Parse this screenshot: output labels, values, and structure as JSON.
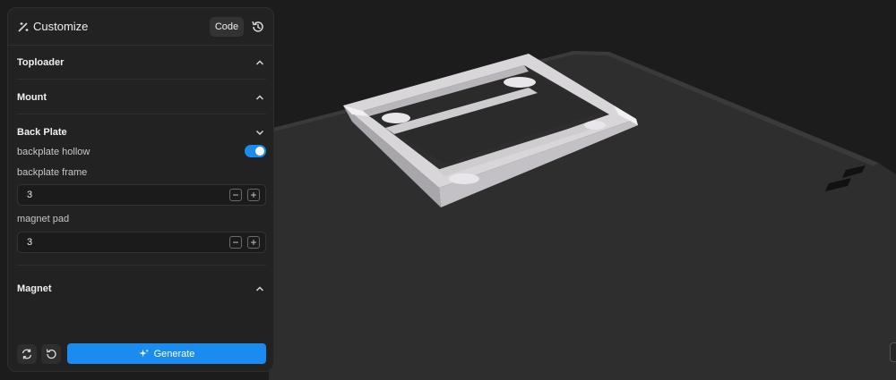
{
  "header": {
    "title": "Customize",
    "code_label": "Code",
    "title_icon": "magic-wand-icon",
    "history_icon": "history-icon"
  },
  "sections": {
    "toploader": {
      "title": "Toploader",
      "expanded": false
    },
    "mount": {
      "title": "Mount",
      "expanded": false
    },
    "back_plate": {
      "title": "Back Plate",
      "expanded": true,
      "backplate_hollow": {
        "label": "backplate hollow",
        "on": true
      },
      "backplate_frame": {
        "label": "backplate frame",
        "value": "3"
      },
      "magnet_pad": {
        "label": "magnet pad",
        "value": "3"
      }
    },
    "magnet": {
      "title": "Magnet",
      "expanded": false
    }
  },
  "footer": {
    "generate_label": "Generate",
    "sparkle_icon": "sparkle-icon",
    "refresh_icon": "refresh-icon",
    "undo_icon": "undo-icon"
  },
  "colors": {
    "accent": "#1a8cf0",
    "panel": "#222222",
    "background": "#1c1c1c",
    "model": "#ececec"
  }
}
